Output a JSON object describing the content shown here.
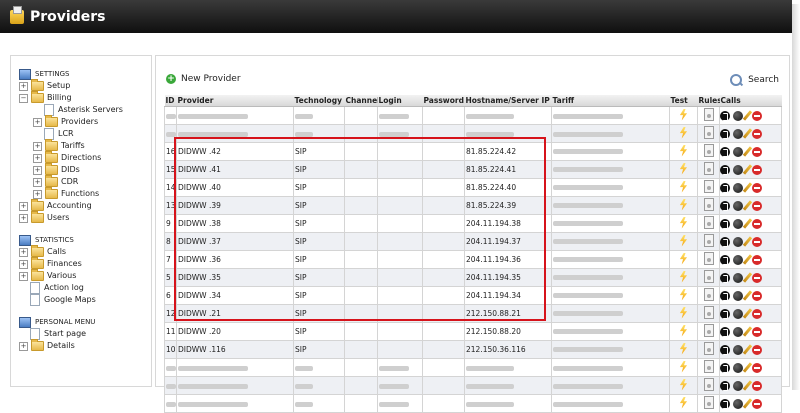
{
  "window": {
    "title": "Providers"
  },
  "sidebar": {
    "settings": {
      "heading": "SETTINGS",
      "items": [
        {
          "label": "Setup",
          "type": "folder",
          "expander": "+"
        },
        {
          "label": "Billing",
          "type": "folder",
          "expander": "−"
        },
        {
          "label": "Asterisk Servers",
          "type": "doc",
          "level": 1
        },
        {
          "label": "Providers",
          "type": "folder",
          "expander": "+",
          "level": 1
        },
        {
          "label": "LCR",
          "type": "doc",
          "level": 1
        },
        {
          "label": "Tariffs",
          "type": "folder",
          "expander": "+",
          "level": 1
        },
        {
          "label": "Directions",
          "type": "folder",
          "expander": "+",
          "level": 1
        },
        {
          "label": "DIDs",
          "type": "folder",
          "expander": "+",
          "level": 1
        },
        {
          "label": "CDR",
          "type": "folder",
          "expander": "+",
          "level": 1
        },
        {
          "label": "Functions",
          "type": "folder",
          "expander": "+",
          "level": 1
        },
        {
          "label": "Accounting",
          "type": "folder",
          "expander": "+"
        },
        {
          "label": "Users",
          "type": "folder",
          "expander": "+"
        }
      ]
    },
    "statistics": {
      "heading": "STATISTICS",
      "items": [
        {
          "label": "Calls",
          "type": "folder",
          "expander": "+"
        },
        {
          "label": "Finances",
          "type": "folder",
          "expander": "+"
        },
        {
          "label": "Various",
          "type": "folder",
          "expander": "+"
        },
        {
          "label": "Action log",
          "type": "doc"
        },
        {
          "label": "Google Maps",
          "type": "doc"
        }
      ]
    },
    "personal": {
      "heading": "PERSONAL MENU",
      "items": [
        {
          "label": "Start page",
          "type": "doc"
        },
        {
          "label": "Details",
          "type": "folder",
          "expander": "+"
        }
      ]
    }
  },
  "toolbar": {
    "new_label": "New Provider",
    "search_label": "Search"
  },
  "table": {
    "columns": [
      "ID",
      "Provider",
      "Technology",
      "Channel",
      "Login",
      "Password",
      "Hostname/Server IP",
      "Tariff",
      "Test",
      "Rules",
      "Calls"
    ],
    "rows": [
      {
        "blurred": true
      },
      {
        "blurred": true
      },
      {
        "id": "16",
        "provider": "DIDWW .42",
        "tech": "SIP",
        "channel": "",
        "login": "",
        "password": "",
        "host": "81.85.224.42",
        "tariff": "",
        "tariff_blurred": true
      },
      {
        "id": "15",
        "provider": "DIDWW .41",
        "tech": "SIP",
        "channel": "",
        "login": "",
        "password": "",
        "host": "81.85.224.41",
        "tariff": "",
        "tariff_blurred": true
      },
      {
        "id": "14",
        "provider": "DIDWW .40",
        "tech": "SIP",
        "channel": "",
        "login": "",
        "password": "",
        "host": "81.85.224.40",
        "tariff": "",
        "tariff_blurred": true
      },
      {
        "id": "13",
        "provider": "DIDWW .39",
        "tech": "SIP",
        "channel": "",
        "login": "",
        "password": "",
        "host": "81.85.224.39",
        "tariff": "",
        "tariff_blurred": true
      },
      {
        "id": "9",
        "provider": "DIDWW .38",
        "tech": "SIP",
        "channel": "",
        "login": "",
        "password": "",
        "host": "204.11.194.38",
        "tariff": "",
        "tariff_blurred": true
      },
      {
        "id": "8",
        "provider": "DIDWW .37",
        "tech": "SIP",
        "channel": "",
        "login": "",
        "password": "",
        "host": "204.11.194.37",
        "tariff": "",
        "tariff_blurred": true
      },
      {
        "id": "7",
        "provider": "DIDWW .36",
        "tech": "SIP",
        "channel": "",
        "login": "",
        "password": "",
        "host": "204.11.194.36",
        "tariff": "",
        "tariff_blurred": true
      },
      {
        "id": "5",
        "provider": "DIDWW .35",
        "tech": "SIP",
        "channel": "",
        "login": "",
        "password": "",
        "host": "204.11.194.35",
        "tariff": "",
        "tariff_blurred": true
      },
      {
        "id": "6",
        "provider": "DIDWW .34",
        "tech": "SIP",
        "channel": "",
        "login": "",
        "password": "",
        "host": "204.11.194.34",
        "tariff": "",
        "tariff_blurred": true
      },
      {
        "id": "12",
        "provider": "DIDWW .21",
        "tech": "SIP",
        "channel": "",
        "login": "",
        "password": "",
        "host": "212.150.88.21",
        "tariff": "",
        "tariff_blurred": true
      },
      {
        "id": "11",
        "provider": "DIDWW .20",
        "tech": "SIP",
        "channel": "",
        "login": "",
        "password": "",
        "host": "212.150.88.20",
        "tariff": "",
        "tariff_blurred": true
      },
      {
        "id": "10",
        "provider": "DIDWW .116",
        "tech": "SIP",
        "channel": "",
        "login": "",
        "password": "",
        "host": "212.150.36.116",
        "tariff": "",
        "tariff_blurred": true
      },
      {
        "blurred": true
      },
      {
        "blurred": true
      },
      {
        "blurred": true
      }
    ]
  },
  "colors": {
    "highlight": "#d6131b",
    "titlebar": "#1a1a1a"
  }
}
